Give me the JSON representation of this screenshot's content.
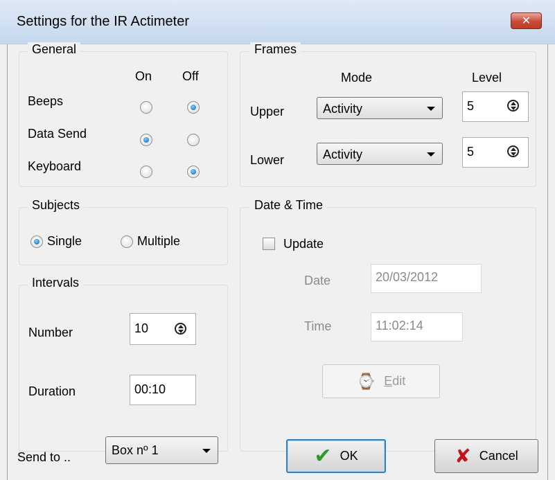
{
  "window": {
    "title": "Settings for the IR Actimeter",
    "close_icon": "close-icon"
  },
  "general": {
    "label": "General",
    "col_on": "On",
    "col_off": "Off",
    "rows": [
      {
        "label": "Beeps",
        "on": false,
        "off": true
      },
      {
        "label": "Data Send",
        "on": true,
        "off": false
      },
      {
        "label": "Keyboard",
        "on": false,
        "off": true
      }
    ]
  },
  "frames": {
    "label": "Frames",
    "mode_header": "Mode",
    "level_header": "Level",
    "upper": {
      "label": "Upper",
      "mode": "Activity",
      "level": "5"
    },
    "lower": {
      "label": "Lower",
      "mode": "Activity",
      "level": "5"
    }
  },
  "subjects": {
    "label": "Subjects",
    "single": "Single",
    "multiple": "Multiple",
    "selected": "Single"
  },
  "datetime": {
    "label": "Date & Time",
    "update_label": "Update",
    "update_checked": false,
    "date_label": "Date",
    "date_value": "20/03/2012",
    "time_label": "Time",
    "time_value": "11:02:14",
    "edit_rest": "dit",
    "edit_mnemonic": "E",
    "edit_icon": "watch-icon"
  },
  "intervals": {
    "label": "Intervals",
    "number_label": "Number",
    "number_value": "10",
    "duration_label": "Duration",
    "duration_value": "00:10"
  },
  "footer": {
    "send_to_label": "Send to ..",
    "send_to_value": "Box nº 1",
    "ok_label": "OK",
    "cancel_label": "Cancel",
    "ok_icon": "checkmark-icon",
    "cancel_icon": "x-icon"
  },
  "colors": {
    "titlebar": "#c5d8ee",
    "close_button": "#c94a35",
    "radio_selected": "#0d60b8",
    "ok_check": "#2a9a2a",
    "cancel_x": "#c0161b"
  }
}
